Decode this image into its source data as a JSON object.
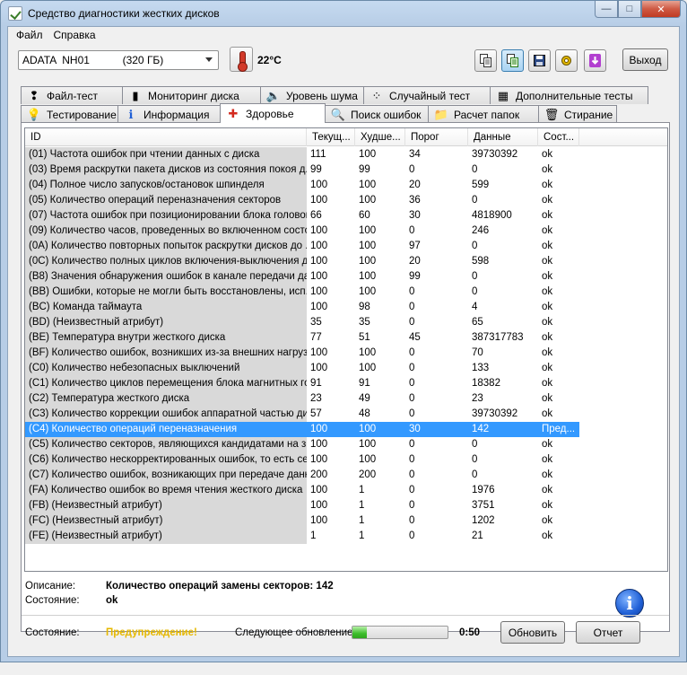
{
  "window": {
    "title": "Средство диагностики жесткиx дисков",
    "ghost_title": "",
    "buttons": {
      "minimize": "—",
      "maximize": "□",
      "close": "✕"
    }
  },
  "menu": {
    "file": "Файл",
    "help": "Справка"
  },
  "toolbar": {
    "disk": "ADATA  NH01           (320 ГБ)",
    "temperature": "22°C",
    "exit": "Выход",
    "tools": [
      "copy-icon",
      "copy-report-icon",
      "save-icon",
      "tools-icon",
      "download-icon"
    ]
  },
  "tabs_row1": [
    {
      "label": "Файл-тест",
      "icon": "file-test-icon",
      "glyph": "❢"
    },
    {
      "label": "Мониторинг диска",
      "icon": "bar-chart-icon",
      "glyph": "▮"
    },
    {
      "label": "Уровень шума",
      "icon": "speaker-icon",
      "glyph": "🔈"
    },
    {
      "label": "Случайный тест",
      "icon": "random-test-icon",
      "glyph": "⁘"
    },
    {
      "label": "Дополнительные тесты",
      "icon": "extra-tests-icon",
      "glyph": "▦"
    }
  ],
  "tabs_row2": [
    {
      "label": "Тестирование",
      "icon": "lightbulb-icon",
      "glyph": "💡"
    },
    {
      "label": "Информация",
      "icon": "info-icon",
      "glyph": "ℹ"
    },
    {
      "label": "Здоровье",
      "icon": "health-cross-icon",
      "glyph": "✚",
      "active": true
    },
    {
      "label": "Поиск ошибок",
      "icon": "magnifier-icon",
      "glyph": "🔍"
    },
    {
      "label": "Расчет папок",
      "icon": "folder-icon",
      "glyph": "📁"
    },
    {
      "label": "Стирание",
      "icon": "trash-icon",
      "glyph": "🗑"
    }
  ],
  "table": {
    "columns": [
      "ID",
      "Текущ...",
      "Худше...",
      "Порог",
      "Данные",
      "Сост..."
    ],
    "rows": [
      [
        "(01) Частота ошибок при чтении данных с диска",
        "111",
        "100",
        "34",
        "39730392",
        "ok"
      ],
      [
        "(03) Время раскрутки пакета дисков из состояния покоя д...",
        "99",
        "99",
        "0",
        "0",
        "ok"
      ],
      [
        "(04) Полное число запусков/остановок шпинделя",
        "100",
        "100",
        "20",
        "599",
        "ok"
      ],
      [
        "(05) Количество операций переназначения секторов",
        "100",
        "100",
        "36",
        "0",
        "ok"
      ],
      [
        "(07) Частота ошибок при позиционировании блока головок",
        "66",
        "60",
        "30",
        "4818900",
        "ok"
      ],
      [
        "(09) Количество часов, проведенных во включенном состо...",
        "100",
        "100",
        "0",
        "246",
        "ok"
      ],
      [
        "(0A) Количество повторных попыток раскрутки дисков до ...",
        "100",
        "100",
        "97",
        "0",
        "ok"
      ],
      [
        "(0C) Количество полных циклов включения-выключения ди...",
        "100",
        "100",
        "20",
        "598",
        "ok"
      ],
      [
        "(B8) Значения обнаружения ошибок в канале передачи да...",
        "100",
        "100",
        "99",
        "0",
        "ok"
      ],
      [
        "(BB) Ошибки, которые не могли быть восстановлены, исп...",
        "100",
        "100",
        "0",
        "0",
        "ok"
      ],
      [
        "(BC) Команда таймаута",
        "100",
        "98",
        "0",
        "4",
        "ok"
      ],
      [
        "(BD) (Неизвестный атрибут)",
        "35",
        "35",
        "0",
        "65",
        "ok"
      ],
      [
        "(BE) Температура внутри жесткого диска",
        "77",
        "51",
        "45",
        "387317783",
        "ok"
      ],
      [
        "(BF) Количество ошибок, возникших из-за внешних нагруз...",
        "100",
        "100",
        "0",
        "70",
        "ok"
      ],
      [
        "(C0) Количество небезопасных выключений",
        "100",
        "100",
        "0",
        "133",
        "ok"
      ],
      [
        "(C1) Количество циклов перемещения блока магнитных го...",
        "91",
        "91",
        "0",
        "18382",
        "ok"
      ],
      [
        "(C2) Температура жесткого диска",
        "23",
        "49",
        "0",
        "23",
        "ok"
      ],
      [
        "(C3) Количество коррекции ошибок аппаратной частью ди...",
        "57",
        "48",
        "0",
        "39730392",
        "ok"
      ],
      [
        "(C4) Количество операций переназначения",
        "100",
        "100",
        "30",
        "142",
        "Пред..."
      ],
      [
        "(C5) Количество секторов, являющихся кандидатами на з...",
        "100",
        "100",
        "0",
        "0",
        "ok"
      ],
      [
        "(C6) Количество нескорректированных ошибок, то есть се...",
        "100",
        "100",
        "0",
        "0",
        "ok"
      ],
      [
        "(C7) Количество ошибок, возникающих при передаче данн...",
        "200",
        "200",
        "0",
        "0",
        "ok"
      ],
      [
        "(FA) Количество ошибок во время чтения жесткого диска",
        "100",
        "1",
        "0",
        "1976",
        "ok"
      ],
      [
        "(FB) (Неизвестный атрибут)",
        "100",
        "1",
        "0",
        "3751",
        "ok"
      ],
      [
        "(FC) (Неизвестный атрибут)",
        "100",
        "1",
        "0",
        "1202",
        "ok"
      ],
      [
        "(FE) (Неизвестный атрибут)",
        "1",
        "1",
        "0",
        "21",
        "ok"
      ]
    ],
    "selected_row": 18
  },
  "details": {
    "description_label": "Описание:",
    "description_value": "Количество операций замены секторов: 142",
    "state_label": "Состояние:",
    "state_value": "ok"
  },
  "status": {
    "state_label": "Состояние:",
    "state_value": "Предупреждение!",
    "state_color": "#e6b800",
    "next_update_label": "Следующее обновление:",
    "progress_fraction": 0.15,
    "time": "0:50",
    "refresh": "Обновить",
    "report": "Отчет"
  }
}
